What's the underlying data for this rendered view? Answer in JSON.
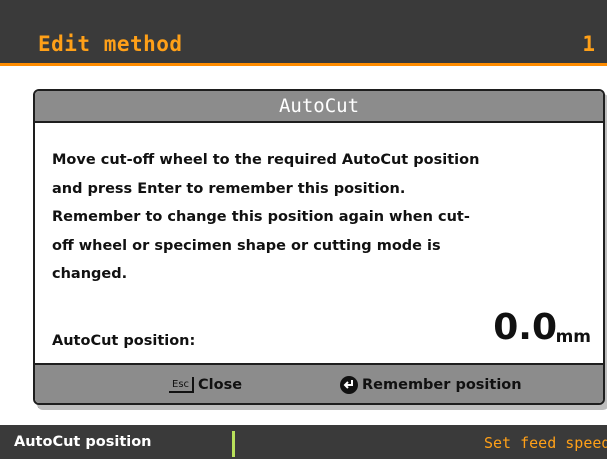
{
  "header": {
    "title": "Edit method",
    "page_number": "1"
  },
  "dialog": {
    "title": "AutoCut",
    "message_lines": [
      "Move cut-off wheel to the required AutoCut position",
      "and press Enter to remember this position.",
      "Remember to change this position again when cut-",
      "off wheel or specimen shape or cutting mode is",
      "changed."
    ],
    "position_label": "AutoCut position:",
    "position_value": "0.0",
    "position_unit": "mm",
    "buttons": {
      "esc_key": "Esc",
      "close_label": "Close",
      "remember_label": "Remember position"
    }
  },
  "statusbar": {
    "left": "AutoCut position",
    "right": "Set feed speed"
  },
  "colors": {
    "accent": "#ffa018",
    "header_bg": "#3a3a3a",
    "dialog_bar": "#8c8c8c",
    "separator": "#b8e05a"
  }
}
